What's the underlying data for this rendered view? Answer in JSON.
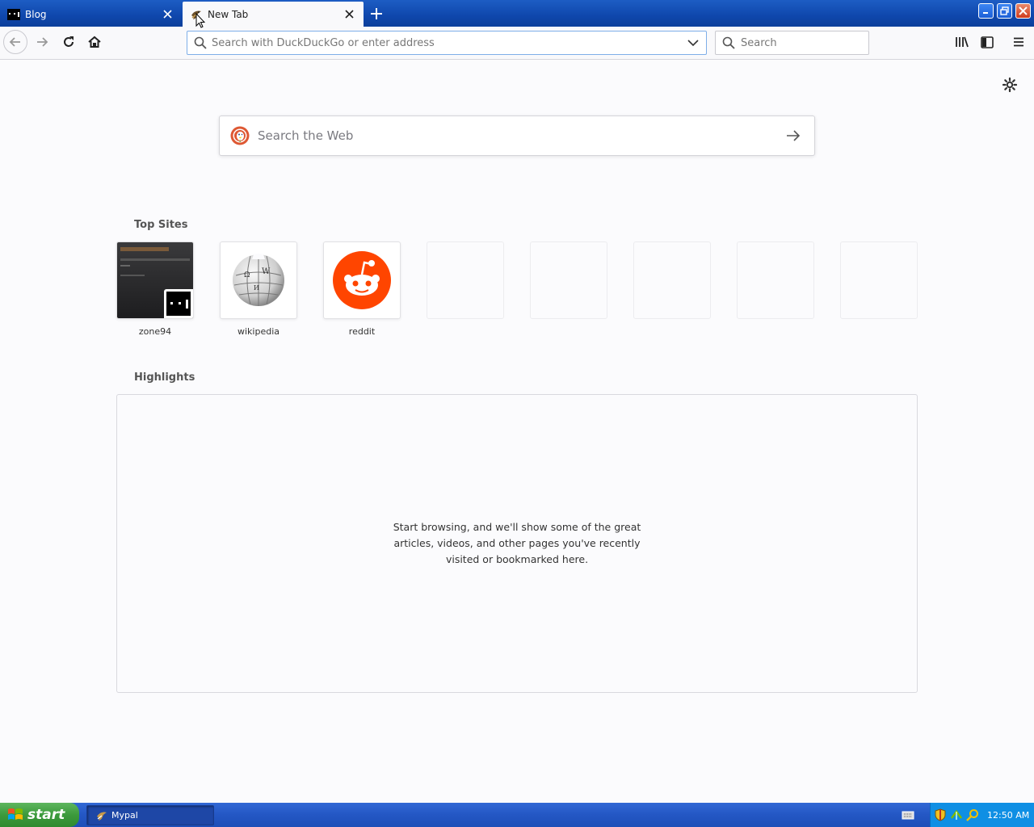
{
  "tabs": [
    {
      "title": "Blog",
      "active": false,
      "favicon": "zone94-favicon"
    },
    {
      "title": "New Tab",
      "active": true,
      "favicon": "mypal-favicon"
    }
  ],
  "toolbar": {
    "url_placeholder": "Search with DuckDuckGo or enter address",
    "search_placeholder": "Search"
  },
  "newtab": {
    "web_search_placeholder": "Search the Web",
    "top_sites_title": "Top Sites",
    "top_sites": [
      {
        "label": "zone94"
      },
      {
        "label": "wikipedia"
      },
      {
        "label": "reddit"
      },
      {
        "label": ""
      },
      {
        "label": ""
      },
      {
        "label": ""
      },
      {
        "label": ""
      },
      {
        "label": ""
      }
    ],
    "highlights_title": "Highlights",
    "highlights_empty": "Start browsing, and we'll show some of the great articles, videos, and other pages you've recently visited or bookmarked here."
  },
  "taskbar": {
    "start_label": "start",
    "task_label": "Mypal",
    "clock": "12:50 AM"
  },
  "colors": {
    "titlebar": "#0f47ac",
    "reddit": "#ff4500",
    "start_green": "#3c9a3c",
    "taskbar_blue": "#2457c4"
  }
}
